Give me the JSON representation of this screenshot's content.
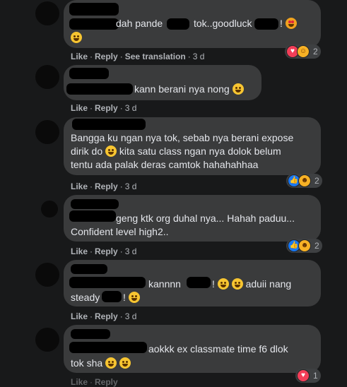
{
  "actions": {
    "like": "Like",
    "reply": "Reply",
    "see_translation": "See translation",
    "dot": "·"
  },
  "comments": [
    {
      "text_a": "dah pande",
      "text_b": "tok..goodluck",
      "text_c": "!",
      "time": "3 d",
      "reactions": {
        "icons": [
          "love",
          "care"
        ],
        "count": "2"
      }
    },
    {
      "text_a": "kann berani nya nong",
      "time": "3 d"
    },
    {
      "line1": "Bangga ku ngan nya tok, sebab nya berani expose",
      "line2a": "dirik do",
      "line2b": "kita satu class ngan nya dolok belum",
      "line3": "tentu ada palak deras camtok hahahahhaa",
      "time": "3 d",
      "reactions": {
        "icons": [
          "like",
          "haha"
        ],
        "count": "2"
      }
    },
    {
      "line1": "geng ktk org duhal nya... Hahah paduu...",
      "line2": "Confident level high2..",
      "time": "3 d",
      "reactions": {
        "icons": [
          "like",
          "haha"
        ],
        "count": "2"
      }
    },
    {
      "text_a": "kannnn",
      "text_b": "!",
      "text_c": "aduii nang",
      "line2a": "steady",
      "line2b": "!",
      "time": "3 d"
    },
    {
      "text_a": "aokkk ex classmate time f6 dlok",
      "line2": "tok sha",
      "reactions": {
        "icons": [
          "love"
        ],
        "count": "1"
      }
    }
  ],
  "colors": {
    "background": "#18191a",
    "bubble": "#3a3b3c",
    "text": "#e4e6eb",
    "muted": "#b0b3b8",
    "like_blue": "#1877f2",
    "love_red": "#f33e58"
  }
}
